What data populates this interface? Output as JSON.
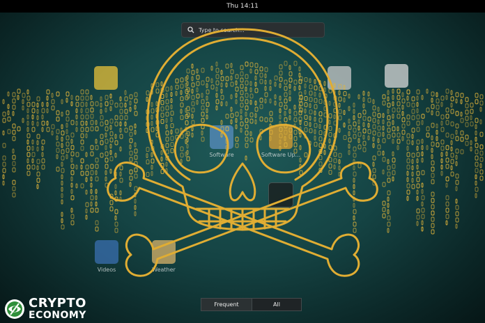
{
  "topbar": {
    "clock": "Thu 14:11"
  },
  "search": {
    "placeholder": "Type to search..."
  },
  "apps": [
    {
      "label": "Videos",
      "color": "#3a6fb0"
    },
    {
      "label": "Weather",
      "color": "#d9b36a"
    },
    {
      "label": "Software",
      "color": "#5a8fc2"
    },
    {
      "label": "Software Up...",
      "color": "#e0a030"
    }
  ],
  "tabs": {
    "frequent": "Frequent",
    "all": "All"
  },
  "logo": {
    "line1": "CRYPTO",
    "line2": "ECONOMY"
  },
  "colors": {
    "matrix": "#e3b53a",
    "skull_outline": "#d9a72e",
    "accent": "#f2c24a"
  }
}
